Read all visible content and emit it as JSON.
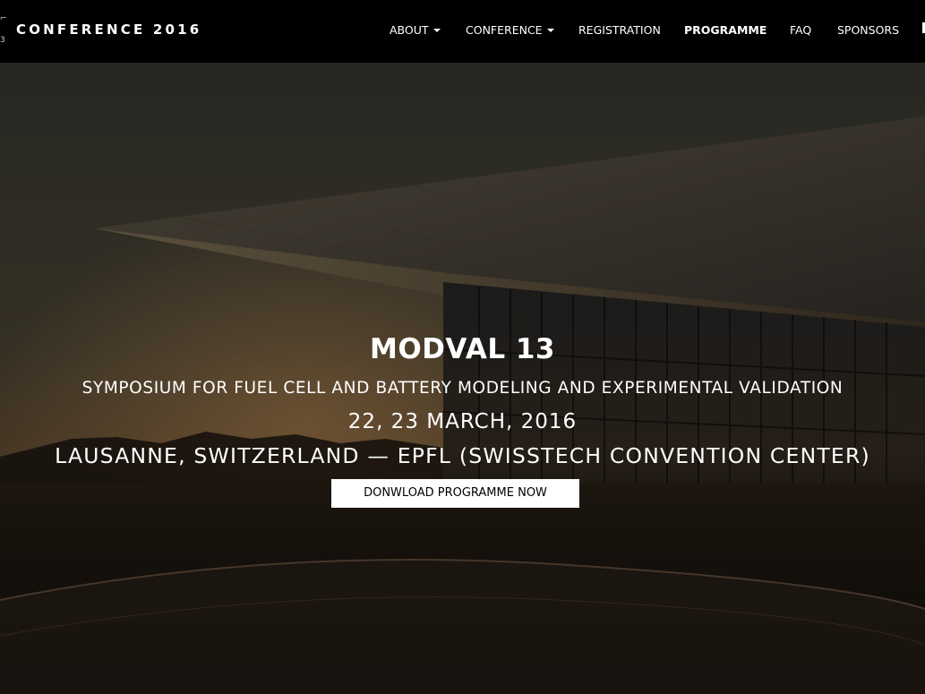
{
  "brand": {
    "logo_mark_top": "⌐",
    "logo_mark_bottom": "3",
    "title": "CONFERENCE 2016"
  },
  "nav": {
    "items": [
      {
        "label": "ABOUT",
        "dropdown": true,
        "active": false
      },
      {
        "label": "CONFERENCE",
        "dropdown": true,
        "active": false
      },
      {
        "label": "REGISTRATION",
        "dropdown": false,
        "active": false
      },
      {
        "label": "PROGRAMME",
        "dropdown": false,
        "active": true
      },
      {
        "label": "FAQ",
        "dropdown": false,
        "active": false
      },
      {
        "label": "SPONSORS",
        "dropdown": false,
        "active": false
      }
    ]
  },
  "hero": {
    "title": "MODVAL 13",
    "subtitle": "SYMPOSIUM FOR FUEL CELL AND BATTERY MODELING AND EXPERIMENTAL VALIDATION",
    "dates": "22, 23 MARCH, 2016",
    "location": "LAUSANNE, SWITZERLAND — EPFL (SWISSTECH CONVENTION CENTER)",
    "cta_label": "DONWLOAD PROGRAMME NOW"
  },
  "colors": {
    "navbar_bg": "#000000",
    "text": "#ffffff",
    "cta_bg": "#ffffff",
    "cta_text": "#000000"
  }
}
